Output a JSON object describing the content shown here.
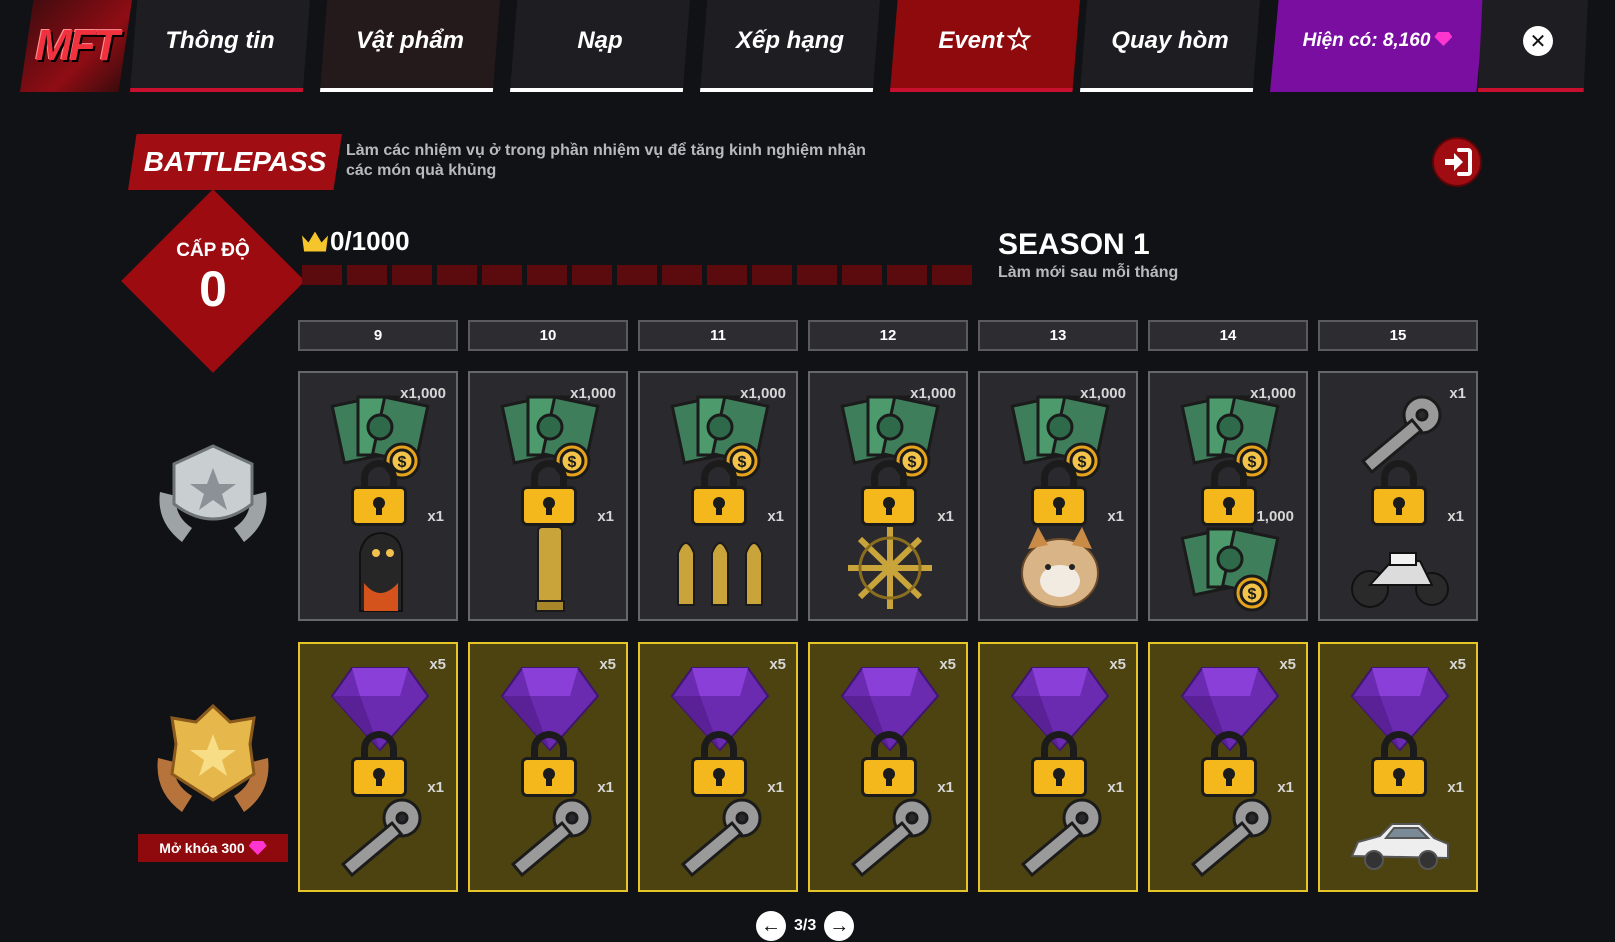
{
  "logo": {
    "text": "MFT"
  },
  "nav": {
    "tabs": [
      {
        "label": "Thông tin",
        "underline": "#c8102e"
      },
      {
        "label": "Vật phẩm",
        "underline": "#ffffff"
      },
      {
        "label": "Nạp",
        "underline": "#ffffff"
      },
      {
        "label": "Xếp hạng",
        "underline": "#ffffff"
      },
      {
        "label": "Event",
        "underline": "#c8102e"
      },
      {
        "label": "Quay hòm",
        "underline": "#ffffff"
      }
    ],
    "balance_label": "Hiện có: 8,160",
    "close_symbol": "✕"
  },
  "header": {
    "title": "BATTLEPASS",
    "description": "Làm các nhiệm vụ ở trong phần nhiệm vụ để tăng kinh nghiệm nhận các món quà khủng"
  },
  "level": {
    "label": "CẤP ĐỘ",
    "value": "0"
  },
  "xp": {
    "text": "0/1000",
    "progress": 0,
    "segments": 15
  },
  "season": {
    "title": "SEASON 1",
    "subtitle": "Làm mới sau mỗi tháng"
  },
  "levels": [
    "9",
    "10",
    "11",
    "12",
    "13",
    "14",
    "15"
  ],
  "free_row": [
    {
      "top_qty": "x1,000",
      "top_icon": "money-icon",
      "mid_qty": "x1",
      "bottom_icon": "monster-mask-icon"
    },
    {
      "top_qty": "x1,000",
      "top_icon": "money-icon",
      "mid_qty": "x1",
      "bottom_icon": "bullet-icon"
    },
    {
      "top_qty": "x1,000",
      "top_icon": "money-icon",
      "mid_qty": "x1",
      "bottom_icon": "bullets-icon"
    },
    {
      "top_qty": "x1,000",
      "top_icon": "money-icon",
      "mid_qty": "x1",
      "bottom_icon": "bullet-wheel-icon"
    },
    {
      "top_qty": "x1,000",
      "top_icon": "money-icon",
      "mid_qty": "x1",
      "bottom_icon": "cat-plush-icon"
    },
    {
      "top_qty": "x1,000",
      "top_icon": "money-icon",
      "mid_qty": "1,000",
      "bottom_icon": "money-icon"
    },
    {
      "top_qty": "x1",
      "top_icon": "key-icon",
      "mid_qty": "x1",
      "bottom_icon": "motorbike-icon"
    }
  ],
  "premium_row": [
    {
      "top_qty": "x5",
      "top_icon": "purple-gem-icon",
      "mid_qty": "x1",
      "bottom_icon": "key-icon"
    },
    {
      "top_qty": "x5",
      "top_icon": "purple-gem-icon",
      "mid_qty": "x1",
      "bottom_icon": "key-icon"
    },
    {
      "top_qty": "x5",
      "top_icon": "purple-gem-icon",
      "mid_qty": "x1",
      "bottom_icon": "key-icon"
    },
    {
      "top_qty": "x5",
      "top_icon": "purple-gem-icon",
      "mid_qty": "x1",
      "bottom_icon": "key-icon"
    },
    {
      "top_qty": "x5",
      "top_icon": "purple-gem-icon",
      "mid_qty": "x1",
      "bottom_icon": "key-icon"
    },
    {
      "top_qty": "x5",
      "top_icon": "purple-gem-icon",
      "mid_qty": "x1",
      "bottom_icon": "key-icon"
    },
    {
      "top_qty": "x5",
      "top_icon": "purple-gem-icon",
      "mid_qty": "x1",
      "bottom_icon": "car-icon"
    }
  ],
  "unlock": {
    "label": "Mở khóa 300"
  },
  "pagination": {
    "text": "3/3",
    "prev": "←",
    "next": "→"
  },
  "colors": {
    "accent_red": "#9b0b10",
    "balance_purple": "#7a0ea0",
    "premium_gold": "#e5c528"
  }
}
